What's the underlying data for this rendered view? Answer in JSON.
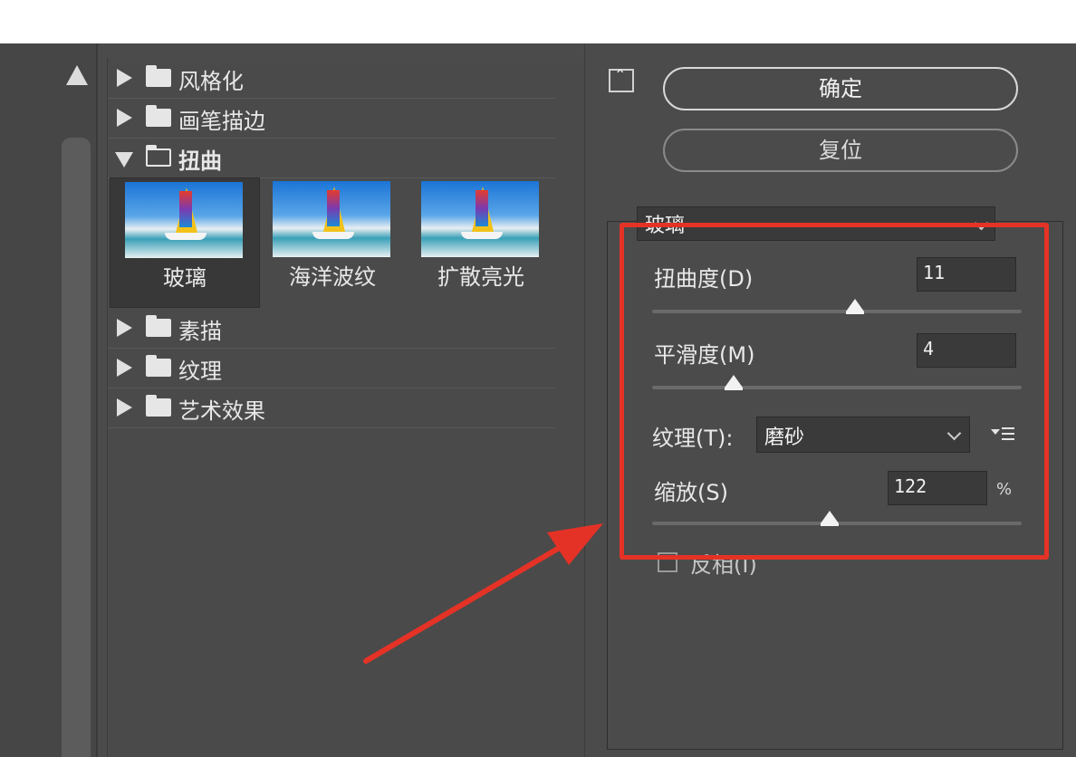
{
  "gallery": {
    "categories_top": [
      {
        "label": "风格化",
        "expanded": false
      },
      {
        "label": "画笔描边",
        "expanded": false
      },
      {
        "label": "扭曲",
        "expanded": true
      }
    ],
    "distort_filters": [
      {
        "label": "玻璃",
        "selected": true
      },
      {
        "label": "海洋波纹",
        "selected": false
      },
      {
        "label": "扩散亮光",
        "selected": false
      }
    ],
    "categories_bottom": [
      {
        "label": "素描",
        "expanded": false
      },
      {
        "label": "纹理",
        "expanded": false
      },
      {
        "label": "艺术效果",
        "expanded": false
      }
    ]
  },
  "buttons": {
    "ok_label": "确定",
    "reset_label": "复位",
    "collapse_glyph": "⌃"
  },
  "settings": {
    "filter_name": "玻璃",
    "distortion": {
      "label": "扭曲度(D)",
      "value": "11",
      "slider_fraction": 0.55
    },
    "smoothness": {
      "label": "平滑度(M)",
      "value": "4",
      "slider_fraction": 0.22
    },
    "texture": {
      "label": "纹理(T):",
      "value": "磨砂"
    },
    "scaling": {
      "label": "缩放(S)",
      "value": "122",
      "unit": "%",
      "slider_fraction": 0.48
    },
    "invert": {
      "label": "反相(I)",
      "checked": false
    }
  },
  "annotation": {
    "color": "#e53226"
  },
  "icons": [
    "scroll-up-arrow",
    "folder-icon",
    "folder-open-icon",
    "expand-triangle-icon",
    "collapse-triangle-icon",
    "collapse-panel-icon",
    "chevron-down-icon",
    "menu-icon"
  ]
}
